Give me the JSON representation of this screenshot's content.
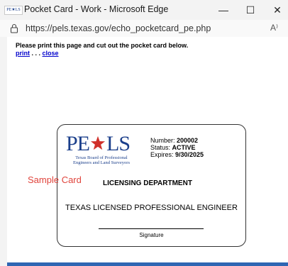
{
  "window": {
    "favicon_text": "PE★LS",
    "title": "Pocket Card - Work - Microsoft Edge",
    "controls": {
      "minimize": "—",
      "maximize": "☐",
      "close": "✕"
    }
  },
  "address_bar": {
    "url": "https://pels.texas.gov/echo_pocketcard_pe.php",
    "read_aloud": "A⁾"
  },
  "page": {
    "instruction": "Please print this page and cut out the pocket card below.",
    "print_link": "print",
    "separator": " . . . ",
    "close_link": "close"
  },
  "card": {
    "logo": {
      "pe": "PE",
      "ls": "LS",
      "line1": "Texas Board of Professional",
      "line2": "Engineers and Land Surveyors",
      "star_color": "#d0302a",
      "text_color": "#1b3f8b"
    },
    "number_label": "Number: ",
    "number_value": "200002",
    "status_label": "Status: ",
    "status_value": "ACTIVE",
    "expires_label": "Expires: ",
    "expires_value": "9/30/2025",
    "sample_overlay": "Sample Card",
    "department": "LICENSING DEPARTMENT",
    "license_type": "TEXAS LICENSED PROFESSIONAL ENGINEER",
    "signature_label": "Signature"
  }
}
